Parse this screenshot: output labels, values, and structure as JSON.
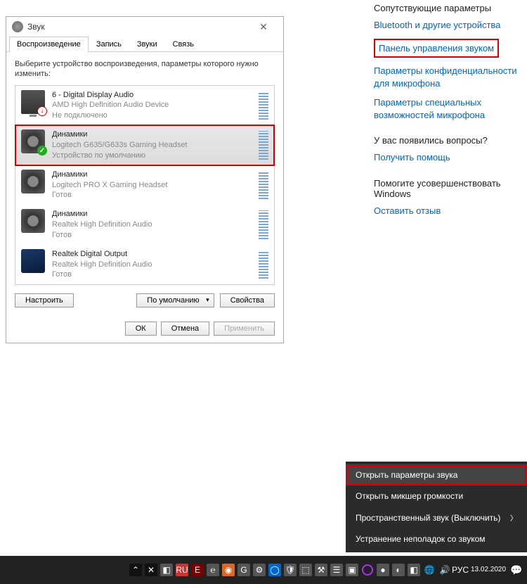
{
  "dialog": {
    "title": "Звук",
    "close": "✕",
    "tabs": [
      "Воспроизведение",
      "Запись",
      "Звуки",
      "Связь"
    ],
    "active_tab": 0,
    "instruction": "Выберите устройство воспроизведения, параметры которого нужно изменить:",
    "devices": [
      {
        "title": "6 - Digital Display Audio",
        "sub": "AMD High Definition Audio Device",
        "status": "Не подключено",
        "icon": "monitor",
        "badge": "down",
        "selected": false,
        "highlighted": false
      },
      {
        "title": "Динамики",
        "sub": "Logitech G635/G633s Gaming Headset",
        "status": "Устройство по умолчанию",
        "icon": "speaker",
        "badge": "check",
        "selected": true,
        "highlighted": true
      },
      {
        "title": "Динамики",
        "sub": "Logitech PRO X Gaming Headset",
        "status": "Готов",
        "icon": "speaker",
        "badge": "",
        "selected": false,
        "highlighted": false
      },
      {
        "title": "Динамики",
        "sub": "Realtek High Definition Audio",
        "status": "Готов",
        "icon": "speaker",
        "badge": "",
        "selected": false,
        "highlighted": false
      },
      {
        "title": "Realtek Digital Output",
        "sub": "Realtek High Definition Audio",
        "status": "Готов",
        "icon": "output",
        "badge": "",
        "selected": false,
        "highlighted": false
      }
    ],
    "btn_configure": "Настроить",
    "btn_default": "По умолчанию",
    "btn_properties": "Свойства",
    "btn_ok": "ОК",
    "btn_cancel": "Отмена",
    "btn_apply": "Применить"
  },
  "rightcol": {
    "h1": "Сопутствующие параметры",
    "l1": "Bluetooth и другие устройства",
    "l2": "Панель управления звуком",
    "l3": "Параметры конфиденциальности для микрофона",
    "l4": "Параметры специальных возможностей микрофона",
    "h2": "У вас появились вопросы?",
    "l5": "Получить помощь",
    "h3": "Помогите усовершенствовать Windows",
    "l6": "Оставить отзыв"
  },
  "ctx": {
    "i1": "Открыть параметры звука",
    "i2": "Открыть микшер громкости",
    "i3": "Пространственный звук (Выключить)",
    "i4": "Устранение неполадок со звуком"
  },
  "taskbar": {
    "lang": "РУС",
    "time": "",
    "date": "13.02.2020"
  }
}
